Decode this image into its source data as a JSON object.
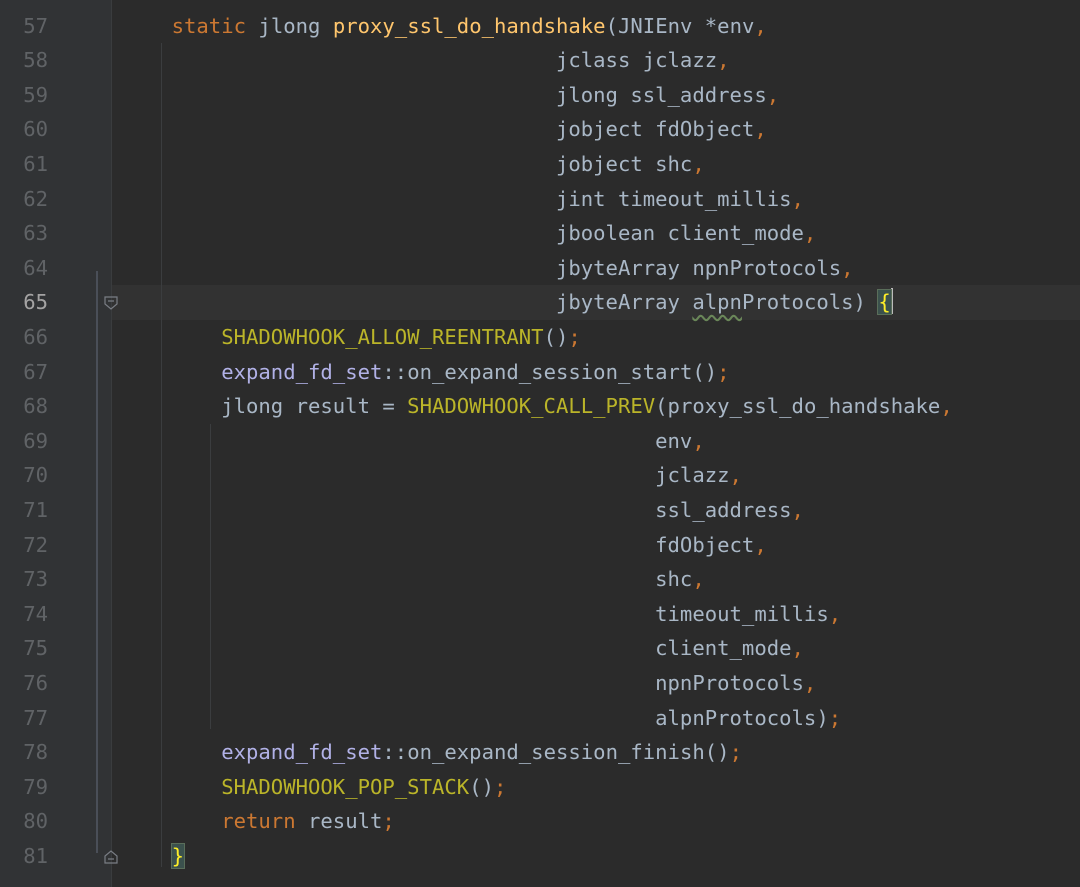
{
  "editor": {
    "theme": "darcula",
    "current_line": 65,
    "colors": {
      "background": "#2b2b2b",
      "gutter": "#313335",
      "keyword": "#cc7832",
      "function": "#ffc66d",
      "macro": "#bbb529",
      "member_function": "#b1b1e6",
      "text": "#a9b7c6",
      "line_number": "#606366"
    },
    "lines": [
      {
        "num": "57",
        "tokens": [
          {
            "t": "    "
          },
          {
            "t": "static",
            "c": "kw"
          },
          {
            "t": " jlong "
          },
          {
            "t": "proxy_ssl_do_handshake",
            "c": "fn"
          },
          {
            "t": "(JNIEnv *env"
          },
          {
            "t": ",",
            "c": "punc"
          }
        ]
      },
      {
        "num": "58",
        "tokens": [
          {
            "t": "                                   jclass jclazz"
          },
          {
            "t": ",",
            "c": "punc"
          }
        ]
      },
      {
        "num": "59",
        "tokens": [
          {
            "t": "                                   jlong ssl_address"
          },
          {
            "t": ",",
            "c": "punc"
          }
        ]
      },
      {
        "num": "60",
        "tokens": [
          {
            "t": "                                   jobject fdObject"
          },
          {
            "t": ",",
            "c": "punc"
          }
        ]
      },
      {
        "num": "61",
        "tokens": [
          {
            "t": "                                   jobject shc"
          },
          {
            "t": ",",
            "c": "punc"
          }
        ]
      },
      {
        "num": "62",
        "tokens": [
          {
            "t": "                                   jint timeout_millis"
          },
          {
            "t": ",",
            "c": "punc"
          }
        ]
      },
      {
        "num": "63",
        "tokens": [
          {
            "t": "                                   jboolean client_mode"
          },
          {
            "t": ",",
            "c": "punc"
          }
        ]
      },
      {
        "num": "64",
        "tokens": [
          {
            "t": "                                   jbyteArray npnProtocols"
          },
          {
            "t": ",",
            "c": "punc"
          }
        ]
      },
      {
        "num": "65",
        "tokens": [
          {
            "t": "                                   jbyteArray "
          },
          {
            "t": "alpn",
            "c": "typo"
          },
          {
            "t": "Protocols) "
          },
          {
            "t": "{",
            "c": "brace"
          },
          {
            "t": "",
            "c": "caret"
          }
        ]
      },
      {
        "num": "66",
        "tokens": [
          {
            "t": "        "
          },
          {
            "t": "SHADOWHOOK_ALLOW_REENTRANT",
            "c": "mac"
          },
          {
            "t": "()"
          },
          {
            "t": ";",
            "c": "punc"
          }
        ]
      },
      {
        "num": "67",
        "tokens": [
          {
            "t": "        "
          },
          {
            "t": "expand_fd_set",
            "c": "mem"
          },
          {
            "t": "::on_expand_session_start"
          },
          {
            "t": "()"
          },
          {
            "t": ";",
            "c": "punc"
          }
        ]
      },
      {
        "num": "68",
        "tokens": [
          {
            "t": "        jlong result = "
          },
          {
            "t": "SHADOWHOOK_CALL_PREV",
            "c": "mac"
          },
          {
            "t": "(proxy_ssl_do_handshake"
          },
          {
            "t": ",",
            "c": "punc"
          }
        ]
      },
      {
        "num": "69",
        "tokens": [
          {
            "t": "                                           env"
          },
          {
            "t": ",",
            "c": "punc"
          }
        ]
      },
      {
        "num": "70",
        "tokens": [
          {
            "t": "                                           jclazz"
          },
          {
            "t": ",",
            "c": "punc"
          }
        ]
      },
      {
        "num": "71",
        "tokens": [
          {
            "t": "                                           ssl_address"
          },
          {
            "t": ",",
            "c": "punc"
          }
        ]
      },
      {
        "num": "72",
        "tokens": [
          {
            "t": "                                           fdObject"
          },
          {
            "t": ",",
            "c": "punc"
          }
        ]
      },
      {
        "num": "73",
        "tokens": [
          {
            "t": "                                           shc"
          },
          {
            "t": ",",
            "c": "punc"
          }
        ]
      },
      {
        "num": "74",
        "tokens": [
          {
            "t": "                                           timeout_millis"
          },
          {
            "t": ",",
            "c": "punc"
          }
        ]
      },
      {
        "num": "75",
        "tokens": [
          {
            "t": "                                           client_mode"
          },
          {
            "t": ",",
            "c": "punc"
          }
        ]
      },
      {
        "num": "76",
        "tokens": [
          {
            "t": "                                           npnProtocols"
          },
          {
            "t": ",",
            "c": "punc"
          }
        ]
      },
      {
        "num": "77",
        "tokens": [
          {
            "t": "                                           alpnProtocols)"
          },
          {
            "t": ";",
            "c": "punc"
          }
        ]
      },
      {
        "num": "78",
        "tokens": [
          {
            "t": "        "
          },
          {
            "t": "expand_fd_set",
            "c": "mem"
          },
          {
            "t": "::on_expand_session_finish"
          },
          {
            "t": "()"
          },
          {
            "t": ";",
            "c": "punc"
          }
        ]
      },
      {
        "num": "79",
        "tokens": [
          {
            "t": "        "
          },
          {
            "t": "SHADOWHOOK_POP_STACK",
            "c": "mac"
          },
          {
            "t": "()"
          },
          {
            "t": ";",
            "c": "punc"
          }
        ]
      },
      {
        "num": "80",
        "tokens": [
          {
            "t": "        "
          },
          {
            "t": "return",
            "c": "kw"
          },
          {
            "t": " result"
          },
          {
            "t": ";",
            "c": "punc"
          }
        ]
      },
      {
        "num": "81",
        "tokens": [
          {
            "t": "    "
          },
          {
            "t": "}",
            "c": "brace"
          }
        ]
      }
    ]
  }
}
